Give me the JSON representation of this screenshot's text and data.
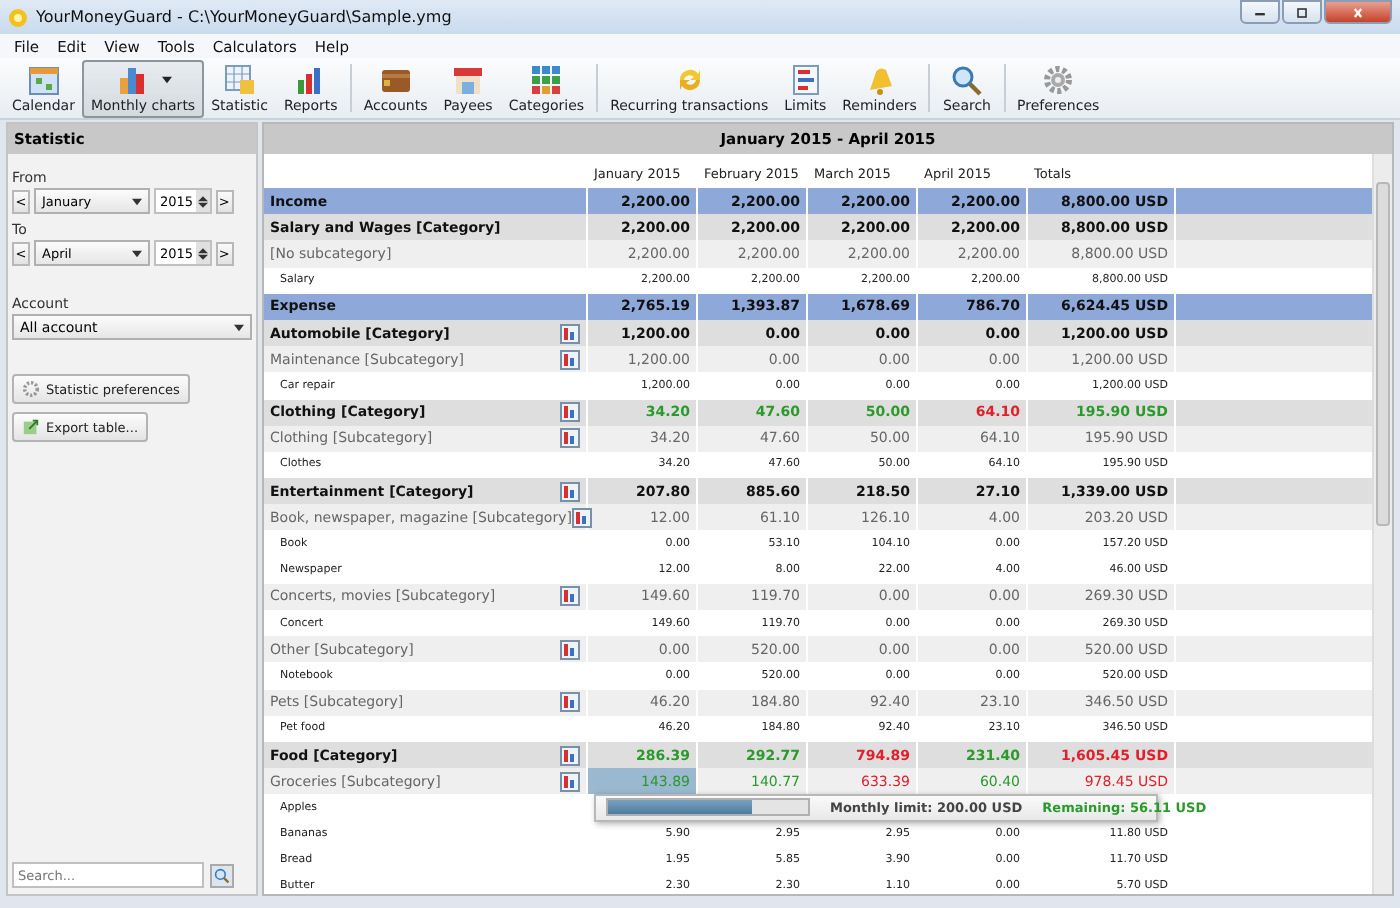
{
  "window": {
    "title": "YourMoneyGuard - C:\\YourMoneyGuard\\Sample.ymg"
  },
  "menu": [
    "File",
    "Edit",
    "View",
    "Tools",
    "Calculators",
    "Help"
  ],
  "toolbar": [
    [
      {
        "label": "Calendar",
        "selected": false
      },
      {
        "label": "Monthly charts",
        "selected": true,
        "dropdown": true
      },
      {
        "label": "Statistic",
        "selected": false
      },
      {
        "label": "Reports",
        "selected": false
      }
    ],
    [
      {
        "label": "Accounts",
        "selected": false
      },
      {
        "label": "Payees",
        "selected": false
      },
      {
        "label": "Categories",
        "selected": false
      }
    ],
    [
      {
        "label": "Recurring transactions",
        "selected": false
      },
      {
        "label": "Limits",
        "selected": false
      },
      {
        "label": "Reminders",
        "selected": false
      }
    ],
    [
      {
        "label": "Search",
        "selected": false
      }
    ],
    [
      {
        "label": "Preferences",
        "selected": false
      }
    ]
  ],
  "sidebar": {
    "title": "Statistic",
    "from": {
      "label": "From",
      "prev": "<",
      "month": "January",
      "year": "2015",
      "next": ">"
    },
    "to": {
      "label": "To",
      "prev": "<",
      "month": "April",
      "year": "2015",
      "next": ">"
    },
    "account": {
      "label": "Account",
      "value": "All account"
    },
    "buttons": [
      "Statistic preferences",
      "Export table..."
    ],
    "search": {
      "placeholder": "Search..."
    }
  },
  "table": {
    "title": "January 2015 - April 2015",
    "columns": [
      "January 2015",
      "February 2015",
      "March 2015",
      "April 2015",
      "Totals"
    ],
    "rows": [
      {
        "kind": "section",
        "label": "Income",
        "cells": [
          "2,200.00",
          "2,200.00",
          "2,200.00",
          "2,200.00",
          "8,800.00 USD"
        ]
      },
      {
        "kind": "category",
        "label": "Salary and Wages [Category]",
        "cells": [
          "2,200.00",
          "2,200.00",
          "2,200.00",
          "2,200.00",
          "8,800.00 USD"
        ]
      },
      {
        "kind": "subcategory",
        "label": "[No subcategory]",
        "cells": [
          "2,200.00",
          "2,200.00",
          "2,200.00",
          "2,200.00",
          "8,800.00 USD"
        ]
      },
      {
        "kind": "item",
        "label": "Salary",
        "cells": [
          "2,200.00",
          "2,200.00",
          "2,200.00",
          "2,200.00",
          "8,800.00 USD"
        ]
      },
      {
        "kind": "section",
        "label": "Expense",
        "cells": [
          "2,765.19",
          "1,393.87",
          "1,678.69",
          "786.70",
          "6,624.45 USD"
        ]
      },
      {
        "kind": "category",
        "label": "Automobile [Category]",
        "limit_icon": true,
        "cells": [
          "1,200.00",
          "0.00",
          "0.00",
          "0.00",
          "1,200.00 USD"
        ]
      },
      {
        "kind": "subcategory",
        "label": "Maintenance [Subcategory]",
        "limit_icon": true,
        "cells": [
          "1,200.00",
          "0.00",
          "0.00",
          "0.00",
          "1,200.00 USD"
        ]
      },
      {
        "kind": "item",
        "label": "Car repair",
        "cells": [
          "1,200.00",
          "0.00",
          "0.00",
          "0.00",
          "1,200.00 USD"
        ]
      },
      {
        "kind": "category",
        "label": "Clothing [Category]",
        "limit_icon": true,
        "cells": [
          {
            "text": "34.20",
            "color": "#2a9a2a"
          },
          {
            "text": "47.60",
            "color": "#2a9a2a"
          },
          {
            "text": "50.00",
            "color": "#2a9a2a"
          },
          {
            "text": "64.10",
            "color": "#e0202a"
          },
          {
            "text": "195.90 USD",
            "color": "#2a9a2a"
          }
        ]
      },
      {
        "kind": "subcategory",
        "label": "Clothing [Subcategory]",
        "limit_icon": true,
        "cells": [
          "34.20",
          "47.60",
          "50.00",
          "64.10",
          "195.90 USD"
        ]
      },
      {
        "kind": "item",
        "label": "Clothes",
        "cells": [
          "34.20",
          "47.60",
          "50.00",
          "64.10",
          "195.90 USD"
        ]
      },
      {
        "kind": "category",
        "label": "Entertainment [Category]",
        "limit_icon": true,
        "cells": [
          "207.80",
          "885.60",
          "218.50",
          "27.10",
          "1,339.00 USD"
        ]
      },
      {
        "kind": "subcategory",
        "label": "Book, newspaper, magazine [Subcategory]",
        "limit_icon": true,
        "cells": [
          "12.00",
          "61.10",
          "126.10",
          "4.00",
          "203.20 USD"
        ]
      },
      {
        "kind": "item",
        "label": "Book",
        "cells": [
          "0.00",
          "53.10",
          "104.10",
          "0.00",
          "157.20 USD"
        ]
      },
      {
        "kind": "item",
        "label": "Newspaper",
        "cells": [
          "12.00",
          "8.00",
          "22.00",
          "4.00",
          "46.00 USD"
        ]
      },
      {
        "kind": "subcategory",
        "label": "Concerts, movies [Subcategory]",
        "limit_icon": true,
        "cells": [
          "149.60",
          "119.70",
          "0.00",
          "0.00",
          "269.30 USD"
        ]
      },
      {
        "kind": "item",
        "label": "Concert",
        "cells": [
          "149.60",
          "119.70",
          "0.00",
          "0.00",
          "269.30 USD"
        ]
      },
      {
        "kind": "subcategory",
        "label": "Other [Subcategory]",
        "limit_icon": true,
        "cells": [
          "0.00",
          "520.00",
          "0.00",
          "0.00",
          "520.00 USD"
        ]
      },
      {
        "kind": "item",
        "label": "Notebook",
        "cells": [
          "0.00",
          "520.00",
          "0.00",
          "0.00",
          "520.00 USD"
        ]
      },
      {
        "kind": "subcategory",
        "label": "Pets [Subcategory]",
        "limit_icon": true,
        "cells": [
          "46.20",
          "184.80",
          "92.40",
          "23.10",
          "346.50 USD"
        ]
      },
      {
        "kind": "item",
        "label": "Pet food",
        "cells": [
          "46.20",
          "184.80",
          "92.40",
          "23.10",
          "346.50 USD"
        ]
      },
      {
        "kind": "category",
        "label": "Food [Category]",
        "limit_icon": true,
        "cells": [
          {
            "text": "286.39",
            "color": "#2a9a2a"
          },
          {
            "text": "292.77",
            "color": "#2a9a2a"
          },
          {
            "text": "794.89",
            "color": "#e0202a"
          },
          {
            "text": "231.40",
            "color": "#2a9a2a"
          },
          {
            "text": "1,605.45 USD",
            "color": "#e0202a"
          }
        ]
      },
      {
        "kind": "subcategory",
        "label": "Groceries [Subcategory]",
        "limit_icon": true,
        "cells": [
          {
            "text": "143.89",
            "color": "#2a9a2a",
            "selected": true
          },
          {
            "text": "140.77",
            "color": "#2a9a2a",
            "selected": false
          },
          {
            "text": "633.39",
            "color": "#e0202a",
            "selected": false
          },
          {
            "text": "60.40",
            "color": "#2a9a2a",
            "selected": false
          },
          {
            "text": "978.45 USD",
            "color": "#e0202a",
            "selected": false
          }
        ]
      },
      {
        "kind": "item",
        "label": "Apples",
        "cells": []
      },
      {
        "kind": "item",
        "label": "Bananas",
        "cells": [
          "5.90",
          "2.95",
          "2.95",
          "0.00",
          "11.80 USD"
        ]
      },
      {
        "kind": "item",
        "label": "Bread",
        "cells": [
          "1.95",
          "5.85",
          "3.90",
          "0.00",
          "11.70 USD"
        ]
      },
      {
        "kind": "item",
        "label": "Butter",
        "cells": [
          "2.30",
          "2.30",
          "1.10",
          "0.00",
          "5.70 USD"
        ]
      }
    ],
    "tooltip": {
      "level": 0.72,
      "limit_label": "Monthly limit:",
      "limit_value": "200.00 USD",
      "remaining_label": "Remaining:",
      "remaining_value": "56.11 USD"
    }
  }
}
